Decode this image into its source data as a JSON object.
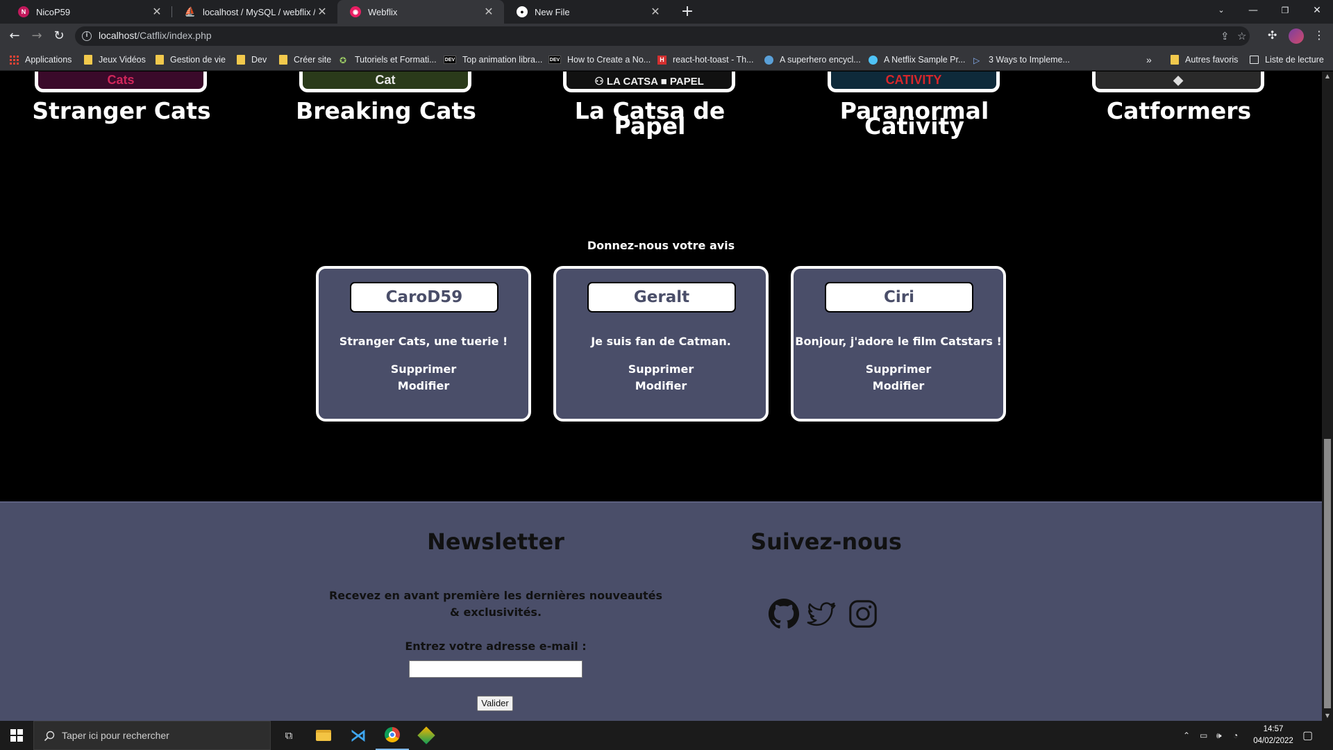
{
  "browser": {
    "tabs": [
      {
        "title": "NicoP59",
        "icon": "github-profile-icon",
        "active": false
      },
      {
        "title": "localhost / MySQL / webflix / arti",
        "icon": "phpmyadmin-icon",
        "active": false
      },
      {
        "title": "Webflix",
        "icon": "webflix-icon",
        "active": true
      },
      {
        "title": "New File",
        "icon": "github-icon",
        "active": false
      }
    ],
    "url_host": "localhost",
    "url_path": "/Catflix/index.php",
    "bookmarks": [
      "Applications",
      "Jeux Vidéos",
      "Gestion de vie",
      "Dev",
      "Créer site",
      "Tutoriels et Formati...",
      "Top animation libra...",
      "How to Create a No...",
      "react-hot-toast - Th...",
      "A superhero encycl...",
      "A Netflix Sample Pr...",
      "3 Ways to Impleme..."
    ],
    "bookmarks_overflow": "»",
    "other_bookmarks": "Autres favoris",
    "reading_list": "Liste de lecture"
  },
  "movies": [
    {
      "title": "Stranger Cats",
      "poster_text": "Cats",
      "poster_color": "#3a0a2a",
      "text_color": "#d0265a"
    },
    {
      "title": "Breaking Cats",
      "poster_text": "Cat",
      "poster_color": "#2a3a1a",
      "text_color": "#e8e8e8"
    },
    {
      "title": "La Catsa de Papel",
      "poster_text": "⚇ LA CATSA ■ PAPEL",
      "poster_color": "#111111",
      "text_color": "#f0f0f0"
    },
    {
      "title": "Paranormal Cativity",
      "poster_text": "CATIVITY",
      "poster_color": "#0e2a3a",
      "text_color": "#d8262a"
    },
    {
      "title": "Catformers",
      "poster_text": "◆",
      "poster_color": "#2a2a2a",
      "text_color": "#dddddd"
    }
  ],
  "reviews": {
    "heading": "Donnez-nous votre avis",
    "items": [
      {
        "author": "CaroD59",
        "comment": "Stranger Cats, une tuerie !",
        "delete": "Supprimer",
        "edit": "Modifier"
      },
      {
        "author": "Geralt",
        "comment": "Je suis fan de Catman.",
        "delete": "Supprimer",
        "edit": "Modifier"
      },
      {
        "author": "Ciri",
        "comment": "Bonjour, j'adore le film Catstars !",
        "delete": "Supprimer",
        "edit": "Modifier"
      }
    ]
  },
  "footer": {
    "newsletter_title": "Newsletter",
    "newsletter_text": "Recevez en avant première les dernières nouveautés & exclusivités.",
    "email_label": "Entrez votre adresse e-mail :",
    "email_value": "",
    "submit_label": "Valider",
    "follow_title": "Suivez-nous",
    "social": [
      "github-icon",
      "twitter-icon",
      "instagram-icon"
    ]
  },
  "taskbar": {
    "search_placeholder": "Taper ici pour rechercher",
    "time": "14:57",
    "date": "04/02/2022"
  },
  "colors": {
    "card_bg": "#4a4e69",
    "footer_bg": "#4a4e69",
    "page_bg": "#000000"
  }
}
